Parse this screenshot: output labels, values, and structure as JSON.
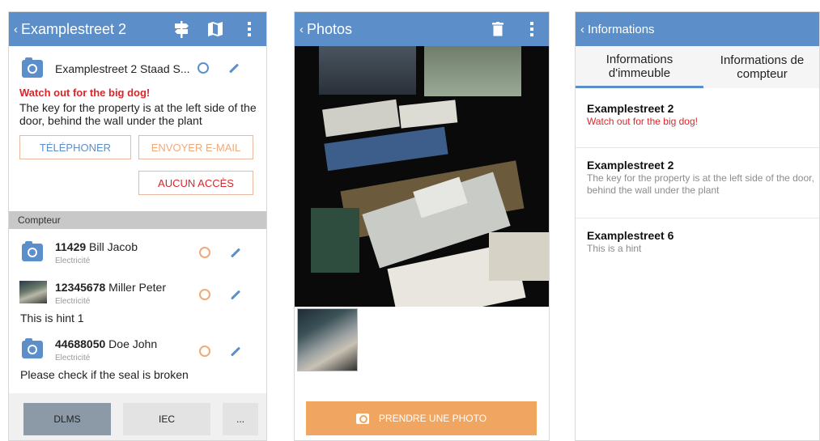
{
  "screens": {
    "property": {
      "title": "Examplestreet 2",
      "address": "Examplestreet 2 Staad S...",
      "warning": "Watch out for the big dog!",
      "key_hint": "The key for the property is at the left side of the door, behind the wall under the plant",
      "buttons": {
        "phone": "TÉLÉPHONER",
        "email": "ENVOYER E-MAIL",
        "no_access": "AUCUN ACCÈS"
      },
      "section_title": "Compteur",
      "meters": [
        {
          "number": "11429",
          "name": " Bill Jacob",
          "kind": "Electricité",
          "note": ""
        },
        {
          "number": "12345678",
          "name": " Miller Peter",
          "kind": "Electricité",
          "note": "This is hint 1"
        },
        {
          "number": "44688050",
          "name": " Doe John",
          "kind": "Electricité",
          "note": "Please check if the seal is broken"
        }
      ],
      "bottom_tabs": [
        "DLMS",
        "IEC",
        "..."
      ]
    },
    "photos": {
      "title": "Photos",
      "take_photo": "PRENDRE UNE PHOTO"
    },
    "informations": {
      "title": "Informations",
      "tabs": [
        "Informations d'immeuble",
        "Informations de compteur"
      ],
      "items": [
        {
          "title": "Examplestreet 2",
          "text": "Watch out for the big dog!",
          "style": "warning"
        },
        {
          "title": "Examplestreet 2",
          "text": "The key for the property is at the left side of the door, behind the wall under the plant",
          "style": "normal"
        },
        {
          "title": "Examplestreet 6",
          "text": "This is a hint",
          "style": "normal"
        }
      ]
    }
  },
  "colors": {
    "appbar": "#5c8fc9",
    "accent_orange": "#f0a560",
    "warning_red": "#d9262b"
  },
  "icons": {
    "back": "chevron-left-icon",
    "signpost": "signpost-icon",
    "map": "map-icon",
    "menu": "overflow-menu-icon",
    "trash": "trash-icon",
    "camera": "camera-icon",
    "locate": "locate-icon",
    "edit": "pencil-icon"
  }
}
